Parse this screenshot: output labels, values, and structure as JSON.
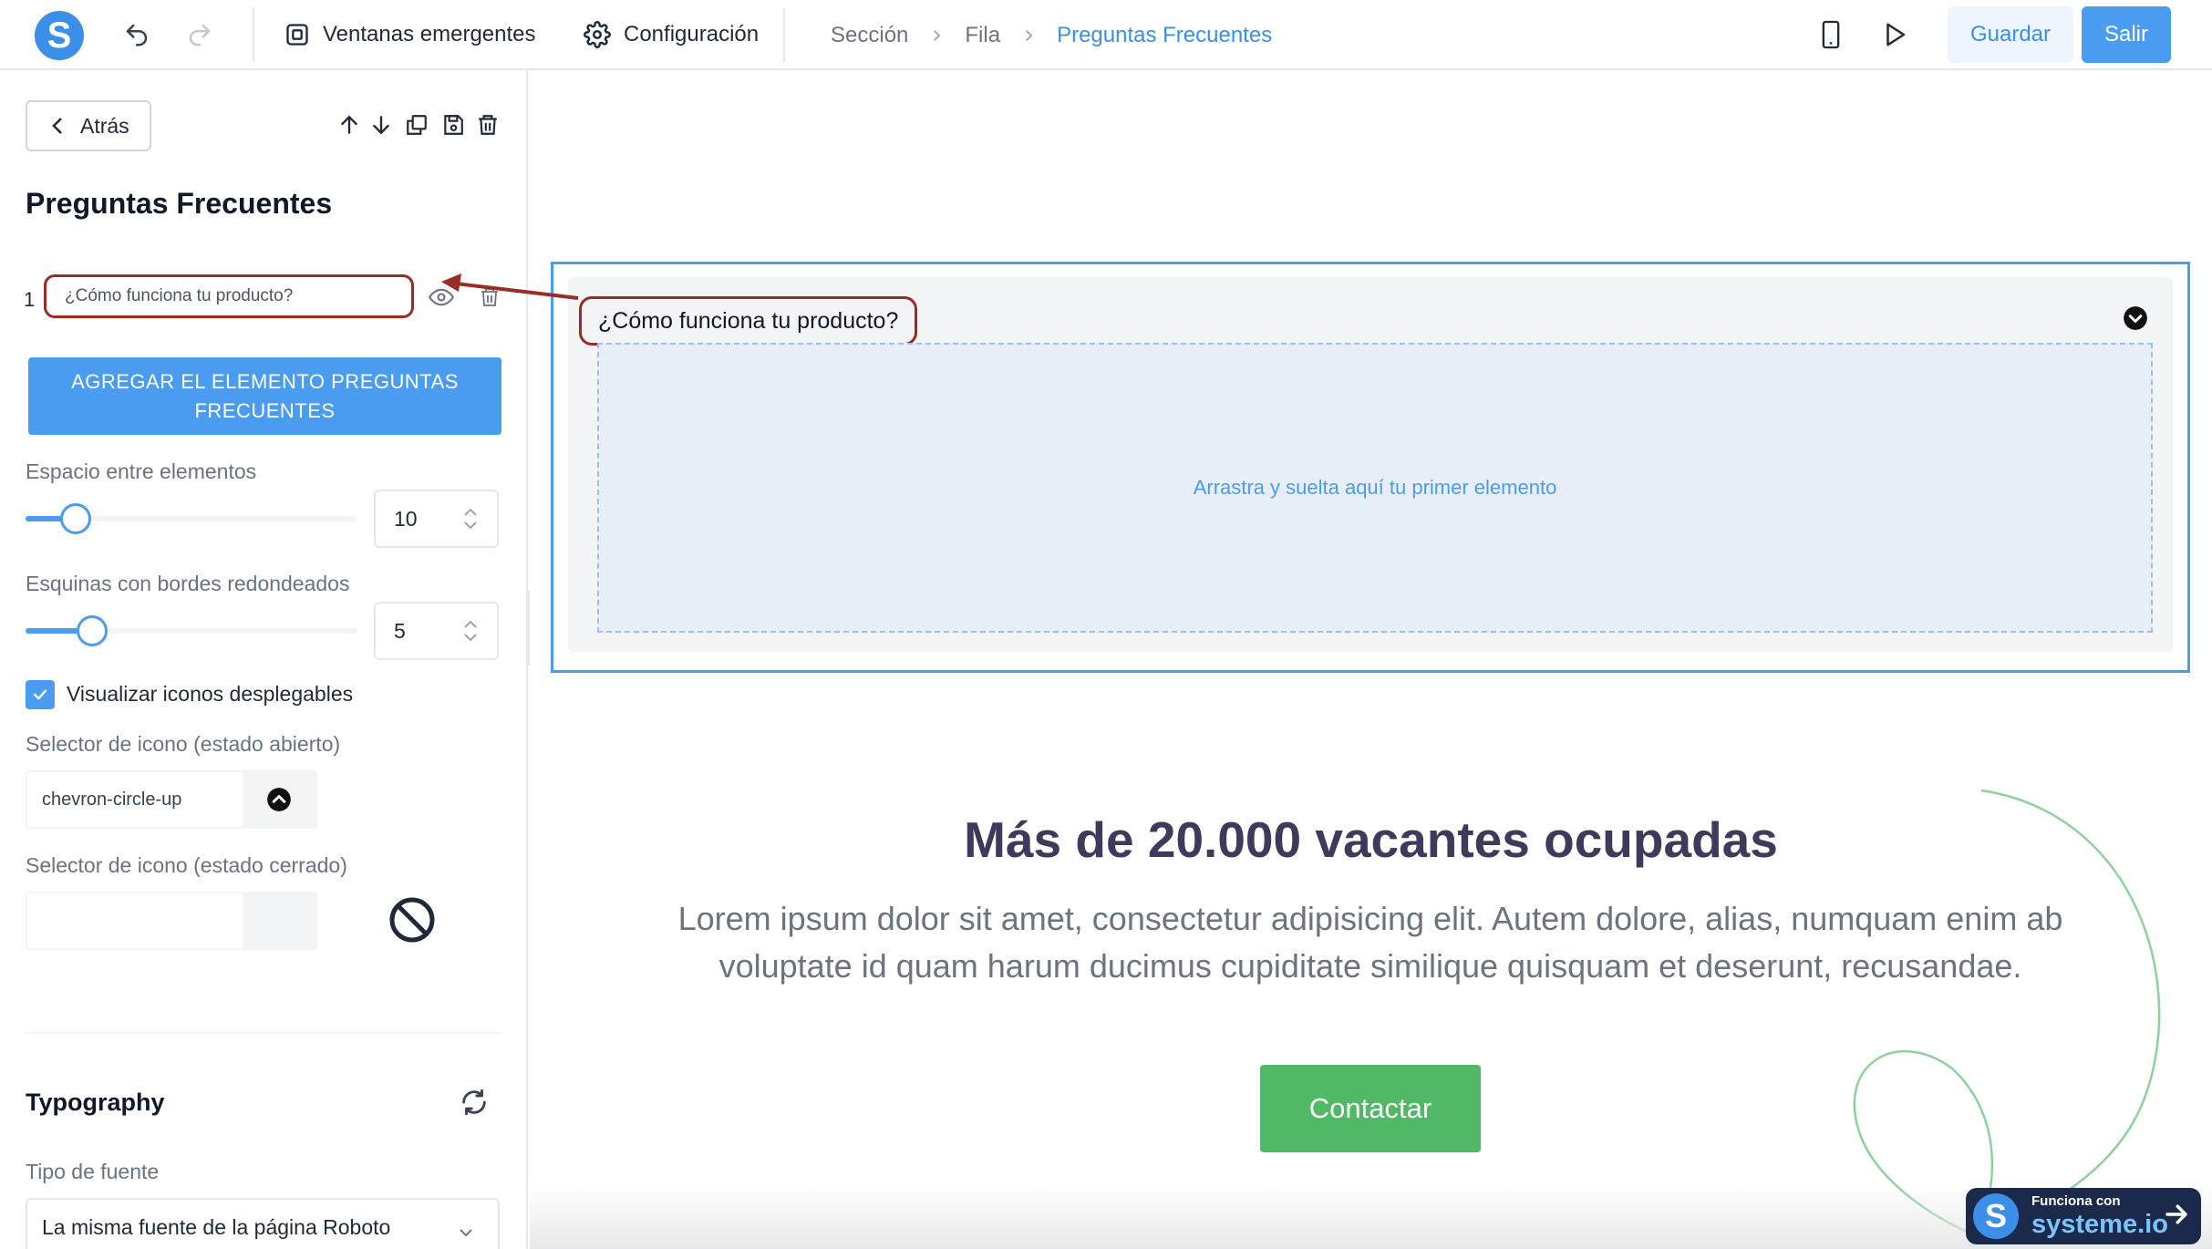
{
  "topbar": {
    "popups_label": "Ventanas emergentes",
    "settings_label": "Configuración",
    "breadcrumb": [
      "Sección",
      "Fila",
      "Preguntas Frecuentes"
    ],
    "save_label": "Guardar",
    "exit_label": "Salir"
  },
  "sidebar": {
    "back_label": "Atrás",
    "title": "Preguntas Frecuentes",
    "items": [
      {
        "number": "1",
        "question": "¿Cómo funciona tu producto?"
      }
    ],
    "add_button": "AGREGAR EL ELEMENTO PREGUNTAS FRECUENTES",
    "spacing": {
      "label": "Espacio entre elementos",
      "value": "10",
      "slider_fraction": 0.15
    },
    "radius": {
      "label": "Esquinas con bordes redondeados",
      "value": "5",
      "slider_fraction": 0.2
    },
    "show_icons": {
      "label": "Visualizar iconos desplegables",
      "checked": true
    },
    "icon_open": {
      "label": "Selector de icono (estado abierto)",
      "value": "chevron-circle-up"
    },
    "icon_closed": {
      "label": "Selector de icono (estado cerrado)",
      "value": ""
    },
    "typography": {
      "title": "Typography",
      "font_label": "Tipo de fuente",
      "font_value": "La misma fuente de la página Roboto"
    }
  },
  "canvas": {
    "faq_question": "¿Cómo funciona tu producto?",
    "drop_zone": "Arrastra y suelta aquí tu primer elemento",
    "hero_title": "Más de 20.000 vacantes ocupadas",
    "hero_text": "Lorem ipsum dolor sit amet, consectetur adipisicing elit. Autem dolore, alias, numquam enim ab voluptate id quam harum ducimus cupiditate similique quisquam et deserunt, recusandae.",
    "cta_label": "Contactar"
  },
  "badge": {
    "small": "Funciona con",
    "big": "systeme.io"
  },
  "colors": {
    "accent": "#4a9cf0",
    "annotation": "#9b2b25",
    "cta": "#4fb966",
    "hero_title": "#3d3a5c"
  }
}
